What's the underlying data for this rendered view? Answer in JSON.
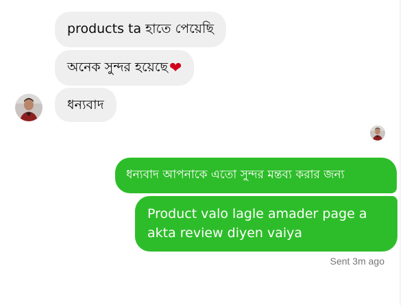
{
  "incoming_messages": [
    {
      "text": "products ta হাতে পেয়েছি"
    },
    {
      "text": "অনেক সুন্দর হয়েছে",
      "emoji": "❤"
    },
    {
      "text": "ধন্যবাদ"
    }
  ],
  "outgoing_messages": [
    {
      "text": "ধন্যবাদ আপনাকে এতো সুন্দর মন্তব্য করার জন্য"
    },
    {
      "text": "Product valo lagle  amader page a akta review diyen vaiya"
    }
  ],
  "status": "Sent 3m ago",
  "colors": {
    "incoming_bubble": "#efefef",
    "outgoing_bubble": "#2ebd2a",
    "outgoing_text": "#ffffff",
    "status_text": "#757575",
    "heart": "#d0021b"
  },
  "icons": {
    "contact_avatar": "avatar-icon",
    "read_receipt": "avatar-icon"
  }
}
